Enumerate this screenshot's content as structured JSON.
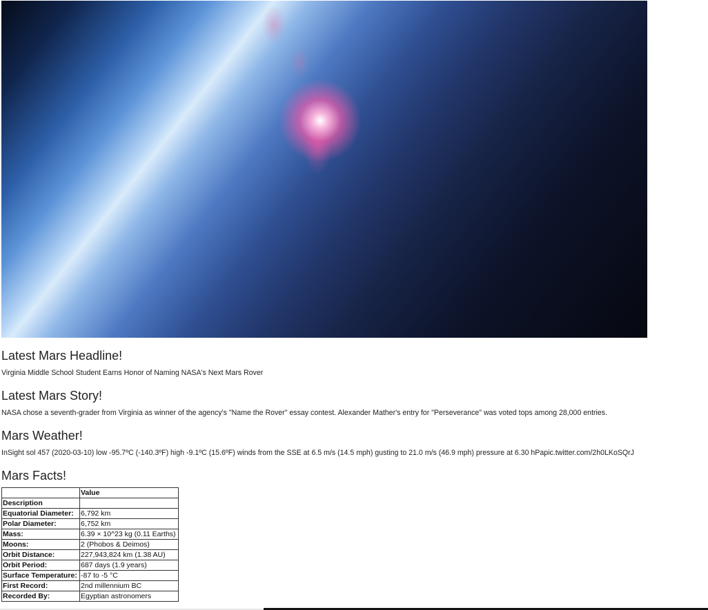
{
  "hero": {
    "image": "earth-horizon-atmosphere-photo",
    "colors": {
      "space": "#060810",
      "atmosphere_glow": "#d9ebfb",
      "aurora_pink": "#ff5aa0"
    }
  },
  "headline": {
    "title": "Latest Mars Headline!",
    "text": "Virginia Middle School Student Earns Honor of Naming NASA's Next Mars Rover"
  },
  "story": {
    "title": "Latest Mars Story!",
    "text": "NASA chose a seventh-grader from Virginia as winner of the agency's \"Name the Rover\" essay contest. Alexander Mather's entry for \"Perseverance\" was voted tops among 28,000 entries."
  },
  "weather": {
    "title": "Mars Weather!",
    "text": "InSight sol 457 (2020-03-10) low -95.7ºC (-140.3ºF) high -9.1ºC (15.6ºF) winds from the SSE at 6.5 m/s (14.5 mph) gusting to 21.0 m/s (46.9 mph) pressure at 6.30 hPapic.twitter.com/2h0LKoSQrJ"
  },
  "facts": {
    "title": "Mars Facts!",
    "header_blank": "",
    "value_header": "Value",
    "description_label": "Description",
    "description_value": "",
    "rows": [
      {
        "label": "Equatorial Diameter:",
        "value": "6,792 km"
      },
      {
        "label": "Polar Diameter:",
        "value": "6,752 km"
      },
      {
        "label": "Mass:",
        "value": "6.39 × 10^23 kg (0.11 Earths)"
      },
      {
        "label": "Moons:",
        "value": "2 (Phobos & Deimos)"
      },
      {
        "label": "Orbit Distance:",
        "value": "227,943,824 km (1.38 AU)"
      },
      {
        "label": "Orbit Period:",
        "value": "687 days (1.9 years)"
      },
      {
        "label": "Surface Temperature:",
        "value": "-87 to -5 °C"
      },
      {
        "label": "First Record:",
        "value": "2nd millennium BC"
      },
      {
        "label": "Recorded By:",
        "value": "Egyptian astronomers"
      }
    ]
  }
}
